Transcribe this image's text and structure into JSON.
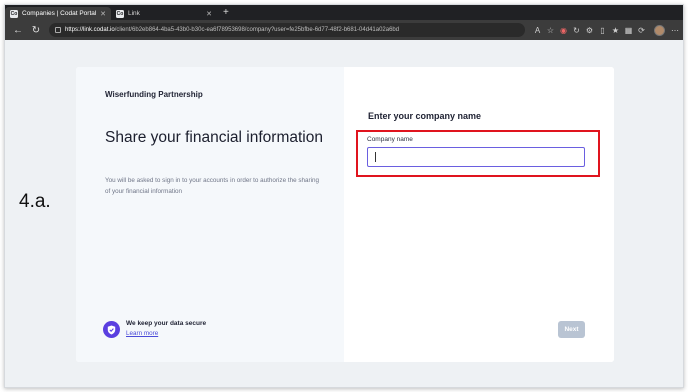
{
  "browser": {
    "tabs": [
      {
        "title": "Companies | Codat Portal",
        "favicon": "Co",
        "active": true
      },
      {
        "title": "Link",
        "favicon": "Co",
        "active": false
      }
    ],
    "new_tab": "+",
    "url_host": "https://link.codat.io",
    "url_path": "/client/6b2eb864-4ba5-43b0-b30c-ea6f78953698/company?user=fe25bfbe-6d77-48f2-b681-04d41a02a6bd"
  },
  "step_label": "4.a.",
  "left_panel": {
    "partner": "Wiserfunding Partnership",
    "headline": "Share your financial information",
    "subtext": "You will be asked to sign in to your accounts in order to authorize the sharing of your financial information",
    "secure_title": "We keep your data secure",
    "learn_more": "Learn more"
  },
  "right_panel": {
    "title": "Enter your company name",
    "field_label": "Company name",
    "field_value": "",
    "next_label": "Next"
  },
  "colors": {
    "accent": "#5a3fe0",
    "highlight": "#e0141e",
    "next_disabled": "#b9c4d3"
  }
}
